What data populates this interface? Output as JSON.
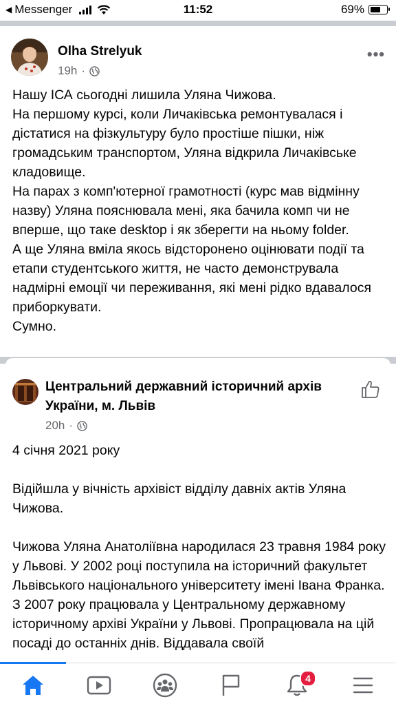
{
  "status_bar": {
    "back_app": "Messenger",
    "time": "11:52",
    "battery": "69%",
    "battery_level": 0.69
  },
  "post": {
    "author": "Olha Strelyuk",
    "time": "19h",
    "separator": "·",
    "paragraphs": [
      "Нашу ІСА сьогодні лишила Уляна Чижова.",
      "На першому курсі, коли Личаківська ремонтувалася і дістатися на фізкультуру було простіше пішки, ніж громадським транспортом, Уляна відкрила Личаківське кладовище.",
      "На парах з комп'ютерної грамотності (курс мав відмінну назву) Уляна пояснювала мені, яка бачила комп чи не вперше, що таке desktop і як зберегти на ньому folder.",
      "А ще Уляна вміла якось відсторонено оцінювати події та етапи студентського життя, не часто демонструвала надмірні емоції чи переживання, які мені рідко вдавалося приборкувати.",
      "Сумно."
    ]
  },
  "shared_post": {
    "author": "Центральний державний історичний архів України, м. Львів",
    "time": "20h",
    "separator": "·",
    "paragraphs": [
      "4 січня 2021 року",
      "Відійшла у вічність архівіст відділу давніх актів Уляна Чижова.",
      "Чижова Уляна Анатоліївна народилася 23 травня 1984 року у Львові. У 2002 році поступила на історичний факультет Львівського національного університету імені Івана Франка. З 2007 року працювала у  Центральному державному історичному архіві України у Львові. Пропрацювала на цій посаді до останніх днів. Віддавала своїй"
    ]
  },
  "tabbar": {
    "notifications_count": "4",
    "active_color": "#1877f2",
    "inactive_color": "#65676b",
    "tabs": [
      "home-icon",
      "watch-icon",
      "groups-icon",
      "pages-flag-icon",
      "notifications-bell-icon",
      "menu-icon"
    ]
  }
}
